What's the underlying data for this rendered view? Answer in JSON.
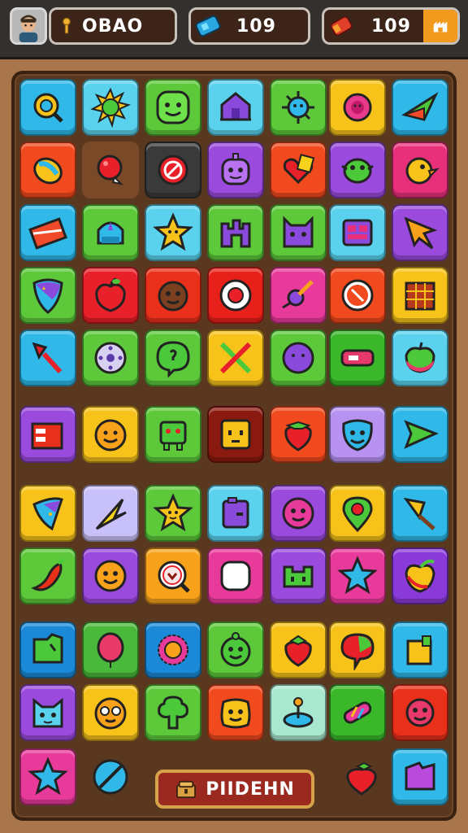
{
  "hud": {
    "player_name": "OBAO",
    "gems": "109",
    "coins": "109"
  },
  "bottom_button": {
    "label": "PIIDEHN"
  },
  "colors": {
    "topbar": "#34302e",
    "board": "#5a3820",
    "background": "#a8764a"
  },
  "tile_icons": {
    "row1": [
      "magnifier-icon",
      "sun-icon",
      "smiley-face-icon",
      "house-icon",
      "gear-creature-icon",
      "flower-creature-icon",
      "paper-plane-icon"
    ],
    "row2": [
      "lemon-icon",
      "balloon-icon",
      "no-sign-icon",
      "robot-face-icon",
      "heart-note-icon",
      "monster-face-icon",
      "chick-icon"
    ],
    "row3": [
      "envelope-icon",
      "crown-icon",
      "star-icon",
      "castle-icon",
      "cat-face-icon",
      "grid-screen-icon",
      "arrow-icon"
    ],
    "row4": [
      "shield-icon",
      "apple-icon",
      "face-icon",
      "target-icon",
      "bug-icon",
      "compass-icon",
      "calendar-icon"
    ],
    "row5": [
      "trowel-icon",
      "dotted-disc-icon",
      "chat-bubble-icon",
      "crossed-swords-icon",
      "purple-face-icon",
      "battery-icon",
      "apple-icon"
    ],
    "row6": [
      "briefcase-icon",
      "orange-face-icon",
      "robot-icon",
      "box-face-icon",
      "strawberry-icon",
      "blue-face-icon",
      "arrow-icon"
    ],
    "row7": [
      "party-hat-icon",
      "pointer-icon",
      "star-face-icon",
      "jar-icon",
      "pink-face-icon",
      "map-pin-icon",
      "ice-cream-icon"
    ],
    "row8": [
      "chili-icon",
      "orange-face-icon",
      "magnifier-icon",
      "blank-icon",
      "frog-icon",
      "star-icon",
      "fruit-icon"
    ],
    "row9": [
      "map-icon",
      "balloon-icon",
      "sunflower-icon",
      "green-face-icon",
      "strawberry-icon",
      "speech-icon",
      "cup-icon"
    ],
    "row10": [
      "cat-face-icon",
      "glasses-face-icon",
      "tree-icon",
      "face-icon",
      "joystick-icon",
      "candy-icon",
      "pink-monster-icon"
    ],
    "row11": [
      "star-icon",
      "no-sign-icon",
      "",
      "",
      "",
      "strawberry-icon",
      "purple-gem-icon"
    ]
  }
}
